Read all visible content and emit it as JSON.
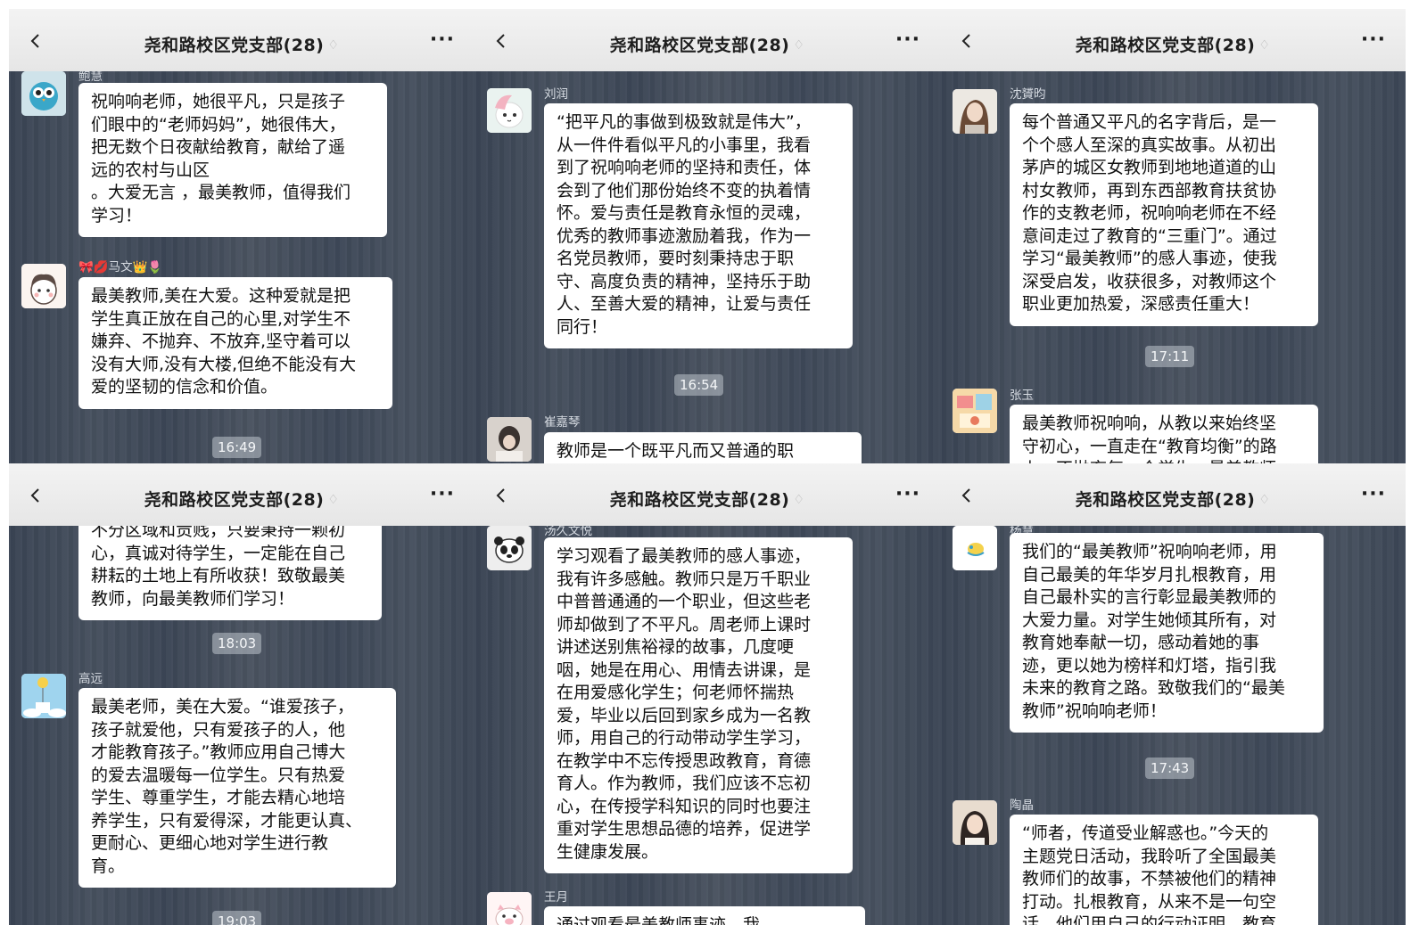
{
  "colors": {
    "nav_bg": "#ededed",
    "chat_bg": "#414b59",
    "bubble": "#ffffff",
    "time_chip": "#a9b0b8"
  },
  "panels": [
    {
      "nav": {
        "title": "尧和路校区党支部(28)",
        "back_icon": "chevron-left-icon",
        "more_label": "···"
      },
      "top_name": "鲍慧",
      "m1": {
        "text": "祝响响老师，她很平凡，只是孩子\n们眼中的“老师妈妈”，她很伟大，\n把无数个日夜献给教育，献给了遥\n远的农村与山区\n。大爱无言 ，最美教师，值得我们\n学习！"
      },
      "m2": {
        "sender": "🎀💋马文👑🌷",
        "text": "最美教师,美在大爱。这种爱就是把\n学生真正放在自己的心里,对学生不\n嫌弃、不抛弃、不放弃,坚守着可以\n没有大师,没有大楼,但绝不能没有大\n爱的坚韧的信念和价值。"
      },
      "time1": "16:49"
    },
    {
      "nav": {
        "title": "尧和路校区党支部(28)",
        "back_icon": "chevron-left-icon",
        "more_label": "···"
      },
      "m1": {
        "sender": "刘润",
        "text": "“把平凡的事做到极致就是伟大”，\n从一件件看似平凡的小事里，我看\n到了祝响响老师的坚持和责任，体\n会到了他们那份始终不变的执着情\n怀。爱与责任是教育永恒的灵魂，\n优秀的教师事迹激励着我，作为一\n名党员教师，要时刻秉持忠于职\n守、高度负责的精神，坚持乐于助\n人、至善大爱的精神，让爱与责任\n同行！"
      },
      "time1": "16:54",
      "m2": {
        "sender": "崔嘉琴",
        "text": "教师是一个既平凡而又普通的职"
      }
    },
    {
      "nav": {
        "title": "尧和路校区党支部(28)",
        "back_icon": "chevron-left-icon",
        "more_label": "···"
      },
      "m1": {
        "sender": "沈贇昀",
        "text": "每个普通又平凡的名字背后，是一\n个个感人至深的真实故事。从初出\n茅庐的城区女教师到地地道道的山\n村女教师，再到东西部教育扶贫协\n作的支教老师，祝响响老师在不经\n意间走过了教育的“三重门”。通过\n学习“最美教师”的感人事迹，使我\n深受启发，收获很多，对教师这个\n职业更加热爱，深感责任重大！"
      },
      "time1": "17:11",
      "m2": {
        "sender": "张玉",
        "text": "最美教师祝响响，从教以来始终坚\n守初心，一直走在“教育均衡”的路\n上，不抛弃每一个学生，最美教师"
      }
    },
    {
      "nav": {
        "title": "尧和路校区党支部(28)",
        "back_icon": "chevron-left-icon",
        "more_label": "···"
      },
      "m1": {
        "text": "不分区域和贡贱，只要秉持一颗初\n心，真诚对待学生，一定能在自己\n耕耘的土地上有所收获！致敬最美\n教师，向最美教师们学习！"
      },
      "time1": "18:03",
      "m2": {
        "sender": "高远",
        "text": "最美老师，美在大爱。“谁爱孩子，\n孩子就爱他，只有爱孩子的人，他\n才能教育孩子。”教师应用自己博大\n的爱去温暖每一位学生。只有热爱\n学生、尊重学生，才能去精心地培\n养学生，只有爱得深，才能更认真、\n更耐心、更细心地对学生进行教\n育。"
      },
      "time2": "19:03"
    },
    {
      "nav": {
        "title": "尧和路校区党支部(28)",
        "back_icon": "chevron-left-icon",
        "more_label": "···"
      },
      "m1": {
        "sender": "汤久文悦",
        "text": "学习观看了最美教师的感人事迹，\n我有许多感触。教师只是万千职业\n中普普通通的一个职业，但这些老\n师却做到了不平凡。周老师上课时\n讲述送别焦裕禄的故事，几度哽\n咽，她是在用心、用情去讲课，是\n在用爱感化学生；何老师怀揣热\n爱，毕业以后回到家乡成为一名教\n师，用自己的行动带动学生学习，\n在教学中不忘传授思政教育，育德\n育人。作为教师，我们应该不忘初\n心，在传授学科知识的同时也要注\n重对学生思想品德的培养，促进学\n生健康发展。"
      },
      "m2": {
        "sender": "王月",
        "text": "通过观看最美教师事迹，我"
      }
    },
    {
      "nav": {
        "title": "尧和路校区党支部(28)",
        "back_icon": "chevron-left-icon",
        "more_label": "···"
      },
      "top_name": "杨慧",
      "m1": {
        "text": "我们的“最美教师”祝响响老师，用\n自己最美的年华岁月扎根教育，用\n自己最朴实的言行彰显最美教师的\n大爱力量。对学生她倾其所有，对\n教育她奉献一切，感动着她的事\n迹，更以她为榜样和灯塔，指引我\n未来的教育之路。致敬我们的“最美\n教师”祝响响老师！"
      },
      "time1": "17:43",
      "m2": {
        "sender": "陶晶",
        "text": "“师者，传道受业解惑也。”今天的\n主题党日活动，我聆听了全国最美\n教师们的故事，不禁被他们的精神\n打动。扎根教育，从来不是一句空\n话，他们用自己的行动证明，教育"
      }
    }
  ]
}
